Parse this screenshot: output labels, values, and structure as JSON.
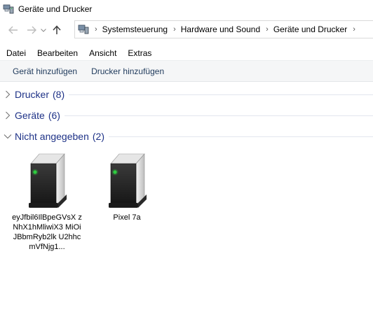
{
  "window": {
    "title": "Geräte und Drucker"
  },
  "navigation": {
    "breadcrumbs": [
      "Systemsteuerung",
      "Hardware und Sound",
      "Geräte und Drucker"
    ]
  },
  "menu": [
    "Datei",
    "Bearbeiten",
    "Ansicht",
    "Extras"
  ],
  "commands": {
    "add_device": "Gerät hinzufügen",
    "add_printer": "Drucker hinzufügen"
  },
  "groups": [
    {
      "label": "Drucker",
      "count": "(8)",
      "expanded": false
    },
    {
      "label": "Geräte",
      "count": "(6)",
      "expanded": false
    },
    {
      "label": "Nicht angegeben",
      "count": "(2)",
      "expanded": true
    }
  ],
  "devices": [
    {
      "label": "eyJfbil6IlBpeGVsX zNhX1hMliwiX3 MiOiJBbmRyb2lk U2hhcmVfNjg1...",
      "icon": "server-tower-icon"
    },
    {
      "label": "Pixel 7a",
      "icon": "server-tower-icon"
    }
  ],
  "colors": {
    "group_header": "#1e3287",
    "command_text": "#1e395b",
    "command_bar_bg": "#f5f6f7",
    "indicator_light": "#2ecc40"
  }
}
